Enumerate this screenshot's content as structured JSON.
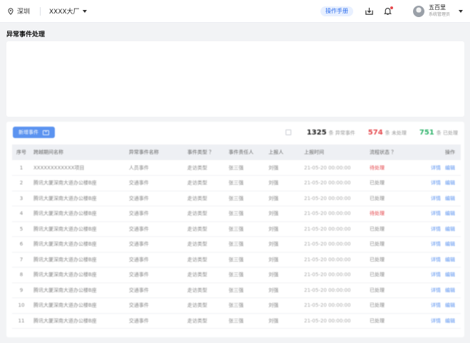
{
  "header": {
    "location": "深圳",
    "factory": "XXXX大厂",
    "manual_label": "操作手册",
    "user_name": "五百里",
    "user_role": "系统管理员"
  },
  "page_title": "异常事件处理",
  "toolbar": {
    "add_label": "新增事件",
    "stats": [
      {
        "num": "1325",
        "label": "条 异常事件",
        "color": "#222222"
      },
      {
        "num": "574",
        "label": "条 未处理",
        "color": "#e5484d"
      },
      {
        "num": "751",
        "label": "条 已处理",
        "color": "#2fb36b"
      }
    ]
  },
  "table": {
    "columns": [
      "序号",
      "跨越期间名称",
      "异常事件名称",
      "事件类型 ？",
      "事件责任人",
      "上报人",
      "上报时间",
      "流程状态 ？",
      "操作"
    ],
    "ops": [
      "详情",
      "编辑"
    ],
    "rows": [
      {
        "idx": "1",
        "name": "XXXXXXXXXXXX项目",
        "event": "人员事件",
        "type": "走访类型",
        "owner": "张三强",
        "reporter": "刘强",
        "time": "21-05-20 00:00:00",
        "status": "待处理",
        "status_color": "red"
      },
      {
        "idx": "2",
        "name": "腾讯大厦深南大道办公楼B座",
        "event": "交通事件",
        "type": "走访类型",
        "owner": "张三强",
        "reporter": "刘强",
        "time": "21-05-20 00:00:00",
        "status": "已处理",
        "status_color": "gray"
      },
      {
        "idx": "3",
        "name": "腾讯大厦深南大道办公楼B座",
        "event": "交通事件",
        "type": "走访类型",
        "owner": "张三强",
        "reporter": "刘强",
        "time": "21-05-20 00:00:00",
        "status": "已处理",
        "status_color": "gray"
      },
      {
        "idx": "4",
        "name": "腾讯大厦深南大道办公楼B座",
        "event": "交通事件",
        "type": "走访类型",
        "owner": "张三强",
        "reporter": "刘强",
        "time": "21-05-20 00:00:00",
        "status": "待处理",
        "status_color": "red"
      },
      {
        "idx": "5",
        "name": "腾讯大厦深南大道办公楼B座",
        "event": "交通事件",
        "type": "走访类型",
        "owner": "张三强",
        "reporter": "刘强",
        "time": "21-05-20 00:00:00",
        "status": "已处理",
        "status_color": "gray"
      },
      {
        "idx": "6",
        "name": "腾讯大厦深南大道办公楼B座",
        "event": "交通事件",
        "type": "走访类型",
        "owner": "张三强",
        "reporter": "刘强",
        "time": "21-05-20 00:00:00",
        "status": "已处理",
        "status_color": "gray"
      },
      {
        "idx": "7",
        "name": "腾讯大厦深南大道办公楼B座",
        "event": "交通事件",
        "type": "走访类型",
        "owner": "张三强",
        "reporter": "刘强",
        "time": "21-05-20 00:00:00",
        "status": "已处理",
        "status_color": "gray"
      },
      {
        "idx": "8",
        "name": "腾讯大厦深南大道办公楼B座",
        "event": "交通事件",
        "type": "走访类型",
        "owner": "张三强",
        "reporter": "刘强",
        "time": "21-05-20 00:00:00",
        "status": "已处理",
        "status_color": "gray"
      },
      {
        "idx": "9",
        "name": "腾讯大厦深南大道办公楼B座",
        "event": "交通事件",
        "type": "走访类型",
        "owner": "张三强",
        "reporter": "刘强",
        "time": "21-05-20 00:00:00",
        "status": "已处理",
        "status_color": "gray"
      },
      {
        "idx": "10",
        "name": "腾讯大厦深南大道办公楼B座",
        "event": "交通事件",
        "type": "走访类型",
        "owner": "张三强",
        "reporter": "刘强",
        "time": "21-05-20 00:00:00",
        "status": "已处理",
        "status_color": "gray"
      },
      {
        "idx": "11",
        "name": "腾讯大厦深南大道办公楼B座",
        "event": "交通事件",
        "type": "走访类型",
        "owner": "张三强",
        "reporter": "刘强",
        "time": "21-05-20 00:00:00",
        "status": "已处理",
        "status_color": "gray"
      }
    ]
  }
}
